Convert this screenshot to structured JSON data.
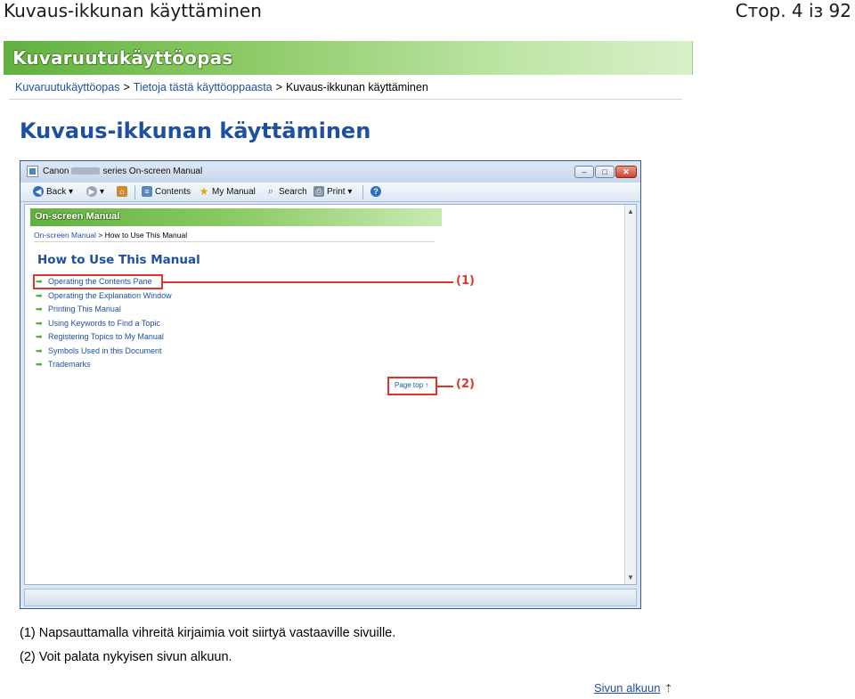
{
  "header": {
    "doc_title": "Kuvaus-ikkunan käyttäminen",
    "page_number": "Стор. 4 із 92"
  },
  "banner": {
    "title": "Kuvaruutukäyttöopas"
  },
  "breadcrumb": {
    "items": [
      "Kuvaruutukäyttöopas",
      "Tietoja tästä käyttöoppaasta",
      "Kuvaus-ikkunan käyttäminen"
    ],
    "separator": ">"
  },
  "main_title": "Kuvaus-ikkunan käyttäminen",
  "screenshot": {
    "window_title_prefix": "Canon",
    "window_title_suffix": "series On-screen Manual",
    "window_buttons": {
      "minimize": "–",
      "maximize": "□",
      "close": "✕"
    },
    "toolbar": {
      "back": "Back",
      "contents": "Contents",
      "my_manual": "My Manual",
      "search": "Search",
      "print": "Print"
    },
    "banner_title": "On-screen Manual",
    "breadcrumb": {
      "root": "On-screen Manual",
      "sep": ">",
      "current": "How to Use This Manual"
    },
    "heading": "How to Use This Manual",
    "links": [
      "Operating the Contents Pane",
      "Operating the Explanation Window",
      "Printing This Manual",
      "Using Keywords to Find a Topic",
      "Registering Topics to My Manual",
      "Symbols Used in this Document",
      "Trademarks"
    ],
    "page_top": "Page top",
    "callouts": [
      "(1)",
      "(2)"
    ]
  },
  "notes": [
    "(1) Napsauttamalla vihreitä kirjaimia voit siirtyä vastaaville sivuille.",
    "(2) Voit palata nykyisen sivun alkuun."
  ],
  "footer": {
    "page_top_label": "Sivun alkuun"
  },
  "colors": {
    "link": "#1f4f9f",
    "accent_green": "#61b13f",
    "callout_red": "#e1332a"
  }
}
